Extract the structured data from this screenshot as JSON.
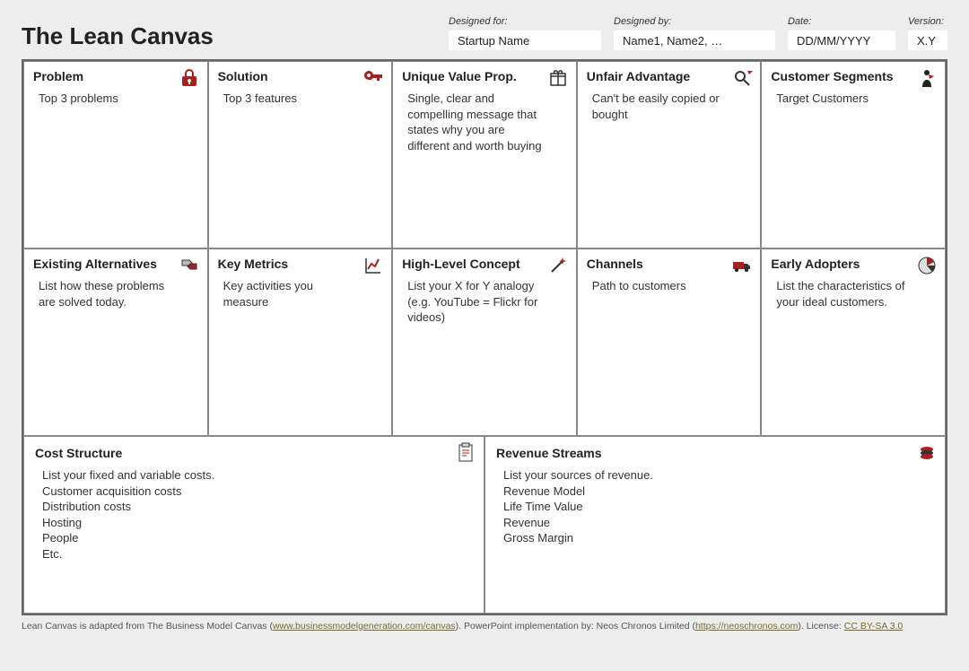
{
  "title": "The Lean Canvas",
  "meta": {
    "designed_for_label": "Designed for:",
    "designed_for_value": "Startup Name",
    "designed_by_label": "Designed by:",
    "designed_by_value": "Name1, Name2, …",
    "date_label": "Date:",
    "date_value": "DD/MM/YYYY",
    "version_label": "Version:",
    "version_value": "X.Y"
  },
  "cells": {
    "problem": {
      "title": "Problem",
      "body": "Top 3 problems"
    },
    "solution": {
      "title": "Solution",
      "body": "Top 3 features"
    },
    "uvp": {
      "title": "Unique Value Prop.",
      "body": "Single, clear and compelling message that states why you are different and worth buying"
    },
    "unfair": {
      "title": "Unfair Advantage",
      "body": "Can't be easily copied or bought"
    },
    "segments": {
      "title": "Customer Segments",
      "body": "Target Customers"
    },
    "existing": {
      "title": "Existing Alternatives",
      "body": "List how these problems are solved today."
    },
    "metrics": {
      "title": "Key Metrics",
      "body": "Key activities you measure"
    },
    "concept": {
      "title": "High-Level Concept",
      "body": "List your X for Y analogy (e.g. YouTube = Flickr for videos)"
    },
    "channels": {
      "title": "Channels",
      "body": "Path to customers"
    },
    "early": {
      "title": "Early Adopters",
      "body": "List the characteristics of your ideal customers."
    },
    "cost": {
      "title": "Cost Structure",
      "lines": [
        "List your fixed and variable costs.",
        "Customer acquisition costs",
        "Distribution costs",
        "Hosting",
        "People",
        "Etc."
      ]
    },
    "revenue": {
      "title": "Revenue Streams",
      "lines": [
        "List your sources of revenue.",
        "Revenue Model",
        "Life Time Value",
        "Revenue",
        "Gross Margin"
      ]
    }
  },
  "footer": {
    "t1": "Lean Canvas is adapted from The Business Model Canvas (",
    "l1": "www.businessmodelgeneration.com/canvas",
    "t2": "). PowerPoint implementation by: Neos Chronos Limited (",
    "l2": "https://neoschronos.com",
    "t3": "). License: ",
    "l3": "CC BY-SA 3.0"
  }
}
